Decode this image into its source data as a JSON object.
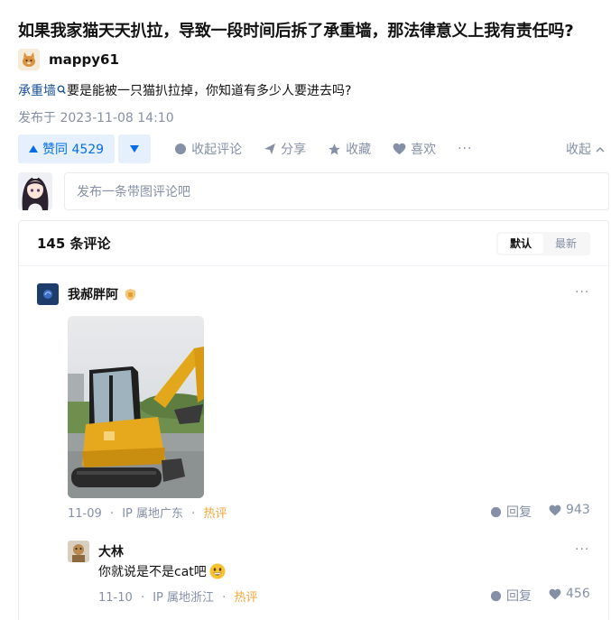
{
  "question": {
    "title": "如果我家猫天天扒拉，导致一段时间后拆了承重墙，那法律意义上我有责任吗?",
    "author": "mappy61",
    "excerpt_keyword": "承重墙",
    "excerpt_text": "要是能被一只猫扒拉掉，你知道有多少人要进去吗?",
    "published": "发布于 2023-11-08 14:10"
  },
  "actions": {
    "vote_up": "赞同 4529",
    "collapse_comments": "收起评论",
    "share": "分享",
    "favorite": "收藏",
    "like": "喜欢",
    "more": "···",
    "collapse": "收起"
  },
  "compose": {
    "placeholder": "发布一条带图评论吧"
  },
  "comments_box": {
    "count_label": "145 条评论",
    "sort_default": "默认",
    "sort_latest": "最新"
  },
  "comments": [
    {
      "name": "我郝胖阿",
      "date": "11-09",
      "ip": "IP 属地广东",
      "hot": "热评",
      "reply": "回复",
      "likes": "943",
      "more": "···"
    },
    {
      "name": "大林",
      "text": "你就说是不是cat吧",
      "date": "11-10",
      "ip": "IP 属地浙江",
      "hot": "热评",
      "reply": "回复",
      "likes": "456",
      "more": "···"
    }
  ],
  "sep": "·",
  "colors": {
    "accent": "#056de8",
    "accent_bg": "#e6f0fd",
    "muted": "#8590a6",
    "hot": "#f1a83a",
    "keyword": "#175199"
  },
  "icons": [
    "cat-avatar",
    "search-icon",
    "caret-up-icon",
    "caret-down-icon",
    "comment-icon",
    "share-icon",
    "star-icon",
    "heart-icon",
    "chevron-up-icon",
    "excavator-photo",
    "shield-badge-icon",
    "emoji-icon"
  ]
}
